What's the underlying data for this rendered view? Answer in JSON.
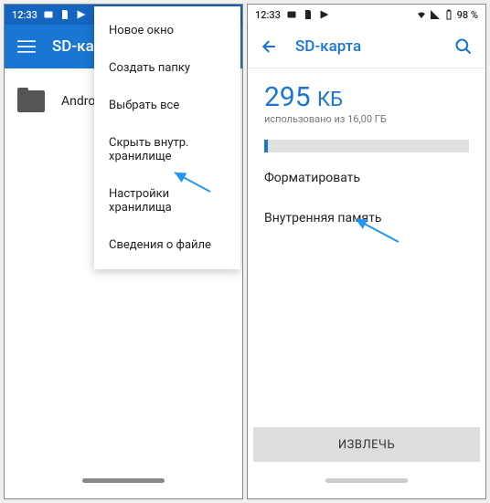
{
  "statusbar": {
    "time": "12:33",
    "battery_pct": "98 %"
  },
  "left_screen": {
    "title": "SD-карта",
    "folder_name": "Android",
    "menu": {
      "items": [
        "Новое окно",
        "Создать папку",
        "Выбрать все",
        "Скрыть внутр. хранилище",
        "Настройки хранилища",
        "Сведения о файле"
      ]
    }
  },
  "right_screen": {
    "title": "SD-карта",
    "storage_value": "295",
    "storage_unit": "КБ",
    "storage_subtext": "использовано из 16,00 ГБ",
    "action_format": "Форматировать",
    "action_internal": "Внутренняя память",
    "eject_label": "ИЗВЛЕЧЬ"
  }
}
